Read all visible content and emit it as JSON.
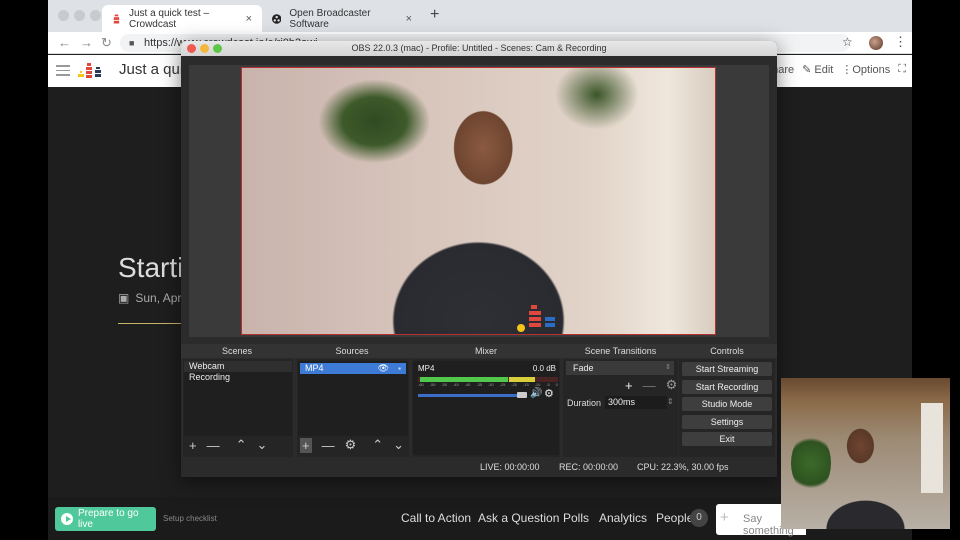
{
  "browser": {
    "tabs": [
      {
        "title": "Just a quick test – Crowdcast",
        "active": true,
        "icon": "crowdcast-icon"
      },
      {
        "title": "Open Broadcaster Software",
        "active": false,
        "icon": "obs-icon"
      }
    ],
    "new_tab_label": "+",
    "close_label": "×",
    "url": "https://www.crowdcast.io/e/ri0b3awj",
    "icons": {
      "back": "←",
      "forward": "→",
      "reload": "↻",
      "lock": "🔒",
      "star": "☆",
      "menu": "⋮"
    }
  },
  "crowdcast": {
    "event_title": "Just a quick test",
    "header_actions": {
      "share": "Share",
      "edit": "Edit",
      "options": "Options",
      "fullscreen": "⛶"
    },
    "heading": "Starting",
    "date": "Sun, April",
    "go_live_label": "Prepare to go live",
    "setup_checklist": "Setup checklist",
    "nav": [
      "Call to Action",
      "Ask a Question",
      "Polls",
      "Analytics",
      "People"
    ],
    "people_count": "0",
    "chat_placeholder": "Say something"
  },
  "obs": {
    "window_title": "OBS 22.0.3 (mac) - Profile: Untitled - Scenes: Cam & Recording",
    "docks": {
      "scenes": "Scenes",
      "sources": "Sources",
      "mixer": "Mixer",
      "transitions": "Scene Transitions",
      "controls": "Controls"
    },
    "scenes": [
      "Webcam",
      "Recording"
    ],
    "sources": [
      {
        "name": "MP4",
        "visible": true,
        "locked": false
      }
    ],
    "mixer": {
      "source": "MP4",
      "level": "0.0 dB",
      "meter_ticks": [
        "-60",
        "-55",
        "-50",
        "-45",
        "-40",
        "-35",
        "-30",
        "-25",
        "-20",
        "-15",
        "-10",
        "-5",
        "0"
      ],
      "volume_fraction": 1.0
    },
    "transitions": {
      "selected": "Fade",
      "duration_label": "Duration",
      "duration_value": "300ms"
    },
    "controls": [
      "Start Streaming",
      "Start Recording",
      "Studio Mode",
      "Settings",
      "Exit"
    ],
    "status": {
      "live": "LIVE: 00:00:00",
      "rec": "REC: 00:00:00",
      "cpu": "CPU: 22.3%, 30.00 fps"
    }
  }
}
